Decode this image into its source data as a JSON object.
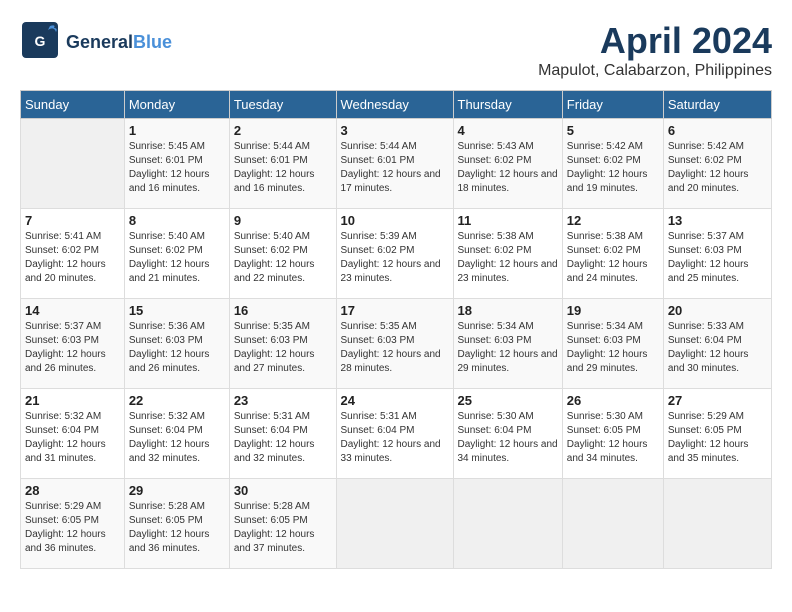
{
  "header": {
    "logo_general": "General",
    "logo_blue": "Blue",
    "month": "April 2024",
    "location": "Mapulot, Calabarzon, Philippines"
  },
  "days_of_week": [
    "Sunday",
    "Monday",
    "Tuesday",
    "Wednesday",
    "Thursday",
    "Friday",
    "Saturday"
  ],
  "weeks": [
    [
      {
        "day": "",
        "sunrise": "",
        "sunset": "",
        "daylight": "",
        "empty": true
      },
      {
        "day": "1",
        "sunrise": "Sunrise: 5:45 AM",
        "sunset": "Sunset: 6:01 PM",
        "daylight": "Daylight: 12 hours and 16 minutes."
      },
      {
        "day": "2",
        "sunrise": "Sunrise: 5:44 AM",
        "sunset": "Sunset: 6:01 PM",
        "daylight": "Daylight: 12 hours and 16 minutes."
      },
      {
        "day": "3",
        "sunrise": "Sunrise: 5:44 AM",
        "sunset": "Sunset: 6:01 PM",
        "daylight": "Daylight: 12 hours and 17 minutes."
      },
      {
        "day": "4",
        "sunrise": "Sunrise: 5:43 AM",
        "sunset": "Sunset: 6:02 PM",
        "daylight": "Daylight: 12 hours and 18 minutes."
      },
      {
        "day": "5",
        "sunrise": "Sunrise: 5:42 AM",
        "sunset": "Sunset: 6:02 PM",
        "daylight": "Daylight: 12 hours and 19 minutes."
      },
      {
        "day": "6",
        "sunrise": "Sunrise: 5:42 AM",
        "sunset": "Sunset: 6:02 PM",
        "daylight": "Daylight: 12 hours and 20 minutes."
      }
    ],
    [
      {
        "day": "7",
        "sunrise": "Sunrise: 5:41 AM",
        "sunset": "Sunset: 6:02 PM",
        "daylight": "Daylight: 12 hours and 20 minutes."
      },
      {
        "day": "8",
        "sunrise": "Sunrise: 5:40 AM",
        "sunset": "Sunset: 6:02 PM",
        "daylight": "Daylight: 12 hours and 21 minutes."
      },
      {
        "day": "9",
        "sunrise": "Sunrise: 5:40 AM",
        "sunset": "Sunset: 6:02 PM",
        "daylight": "Daylight: 12 hours and 22 minutes."
      },
      {
        "day": "10",
        "sunrise": "Sunrise: 5:39 AM",
        "sunset": "Sunset: 6:02 PM",
        "daylight": "Daylight: 12 hours and 23 minutes."
      },
      {
        "day": "11",
        "sunrise": "Sunrise: 5:38 AM",
        "sunset": "Sunset: 6:02 PM",
        "daylight": "Daylight: 12 hours and 23 minutes."
      },
      {
        "day": "12",
        "sunrise": "Sunrise: 5:38 AM",
        "sunset": "Sunset: 6:02 PM",
        "daylight": "Daylight: 12 hours and 24 minutes."
      },
      {
        "day": "13",
        "sunrise": "Sunrise: 5:37 AM",
        "sunset": "Sunset: 6:03 PM",
        "daylight": "Daylight: 12 hours and 25 minutes."
      }
    ],
    [
      {
        "day": "14",
        "sunrise": "Sunrise: 5:37 AM",
        "sunset": "Sunset: 6:03 PM",
        "daylight": "Daylight: 12 hours and 26 minutes."
      },
      {
        "day": "15",
        "sunrise": "Sunrise: 5:36 AM",
        "sunset": "Sunset: 6:03 PM",
        "daylight": "Daylight: 12 hours and 26 minutes."
      },
      {
        "day": "16",
        "sunrise": "Sunrise: 5:35 AM",
        "sunset": "Sunset: 6:03 PM",
        "daylight": "Daylight: 12 hours and 27 minutes."
      },
      {
        "day": "17",
        "sunrise": "Sunrise: 5:35 AM",
        "sunset": "Sunset: 6:03 PM",
        "daylight": "Daylight: 12 hours and 28 minutes."
      },
      {
        "day": "18",
        "sunrise": "Sunrise: 5:34 AM",
        "sunset": "Sunset: 6:03 PM",
        "daylight": "Daylight: 12 hours and 29 minutes."
      },
      {
        "day": "19",
        "sunrise": "Sunrise: 5:34 AM",
        "sunset": "Sunset: 6:03 PM",
        "daylight": "Daylight: 12 hours and 29 minutes."
      },
      {
        "day": "20",
        "sunrise": "Sunrise: 5:33 AM",
        "sunset": "Sunset: 6:04 PM",
        "daylight": "Daylight: 12 hours and 30 minutes."
      }
    ],
    [
      {
        "day": "21",
        "sunrise": "Sunrise: 5:32 AM",
        "sunset": "Sunset: 6:04 PM",
        "daylight": "Daylight: 12 hours and 31 minutes."
      },
      {
        "day": "22",
        "sunrise": "Sunrise: 5:32 AM",
        "sunset": "Sunset: 6:04 PM",
        "daylight": "Daylight: 12 hours and 32 minutes."
      },
      {
        "day": "23",
        "sunrise": "Sunrise: 5:31 AM",
        "sunset": "Sunset: 6:04 PM",
        "daylight": "Daylight: 12 hours and 32 minutes."
      },
      {
        "day": "24",
        "sunrise": "Sunrise: 5:31 AM",
        "sunset": "Sunset: 6:04 PM",
        "daylight": "Daylight: 12 hours and 33 minutes."
      },
      {
        "day": "25",
        "sunrise": "Sunrise: 5:30 AM",
        "sunset": "Sunset: 6:04 PM",
        "daylight": "Daylight: 12 hours and 34 minutes."
      },
      {
        "day": "26",
        "sunrise": "Sunrise: 5:30 AM",
        "sunset": "Sunset: 6:05 PM",
        "daylight": "Daylight: 12 hours and 34 minutes."
      },
      {
        "day": "27",
        "sunrise": "Sunrise: 5:29 AM",
        "sunset": "Sunset: 6:05 PM",
        "daylight": "Daylight: 12 hours and 35 minutes."
      }
    ],
    [
      {
        "day": "28",
        "sunrise": "Sunrise: 5:29 AM",
        "sunset": "Sunset: 6:05 PM",
        "daylight": "Daylight: 12 hours and 36 minutes."
      },
      {
        "day": "29",
        "sunrise": "Sunrise: 5:28 AM",
        "sunset": "Sunset: 6:05 PM",
        "daylight": "Daylight: 12 hours and 36 minutes."
      },
      {
        "day": "30",
        "sunrise": "Sunrise: 5:28 AM",
        "sunset": "Sunset: 6:05 PM",
        "daylight": "Daylight: 12 hours and 37 minutes."
      },
      {
        "day": "",
        "empty": true
      },
      {
        "day": "",
        "empty": true
      },
      {
        "day": "",
        "empty": true
      },
      {
        "day": "",
        "empty": true
      }
    ]
  ]
}
